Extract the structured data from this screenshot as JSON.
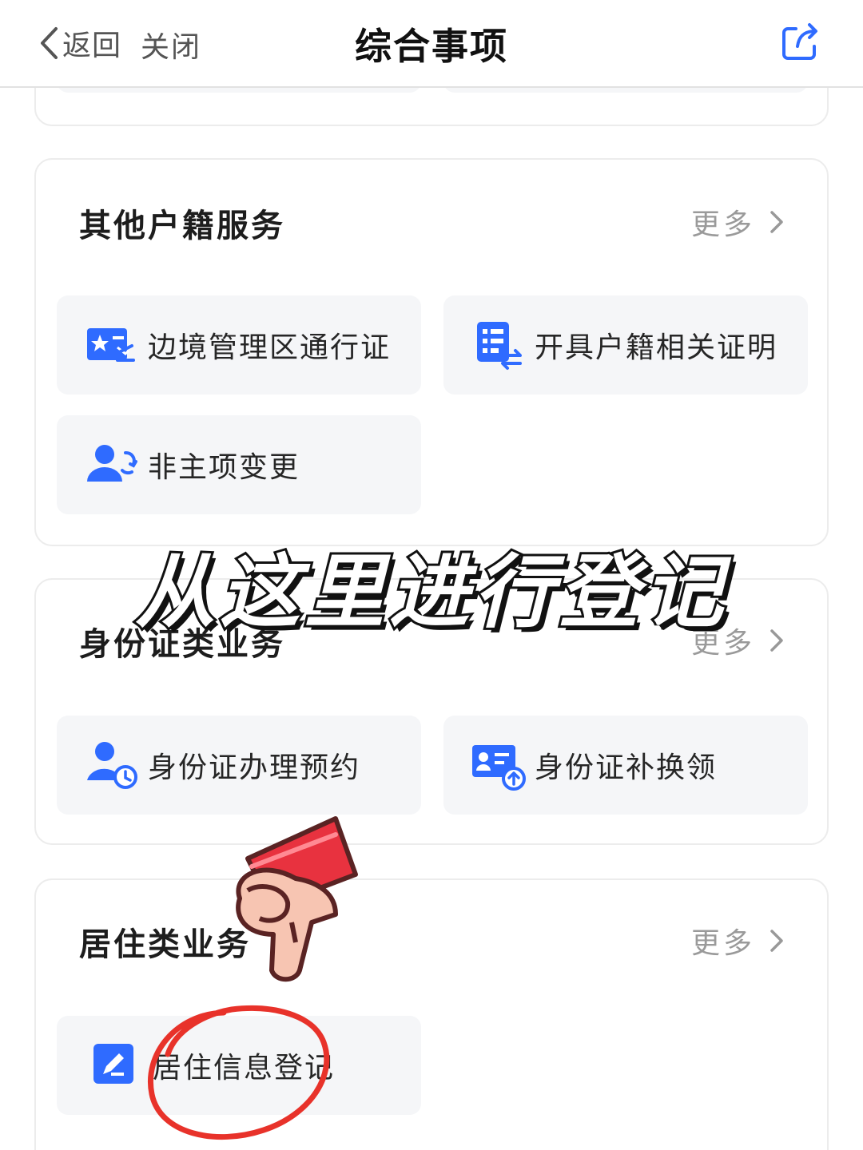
{
  "navbar": {
    "back_label": "返回",
    "close_label": "关闭",
    "title": "综合事项",
    "share_icon": "share-icon"
  },
  "sections": [
    {
      "title": "其他户籍服务",
      "more_label": "更多",
      "items": [
        {
          "label": "边境管理区通行证",
          "icon": "border-pass-icon"
        },
        {
          "label": "开具户籍相关证明",
          "icon": "certificate-list-icon"
        },
        {
          "label": "非主项变更",
          "icon": "person-change-icon"
        }
      ]
    },
    {
      "title": "身份证类业务",
      "more_label": "更多",
      "items": [
        {
          "label": "身份证办理预约",
          "icon": "person-clock-icon"
        },
        {
          "label": "身份证补换领",
          "icon": "id-card-upload-icon"
        }
      ]
    },
    {
      "title": "居住类业务",
      "more_label": "更多",
      "items": [
        {
          "label": "居住信息登记",
          "icon": "edit-pen-icon"
        }
      ]
    }
  ],
  "overlay": {
    "caption": "从这里进行登记",
    "pointer": "pointing-hand-icon",
    "highlight": "red-circle-mark"
  },
  "colors": {
    "accent": "#2F6BFF",
    "card_tile_bg": "#F5F6F8",
    "highlight_red": "#E8322A"
  }
}
